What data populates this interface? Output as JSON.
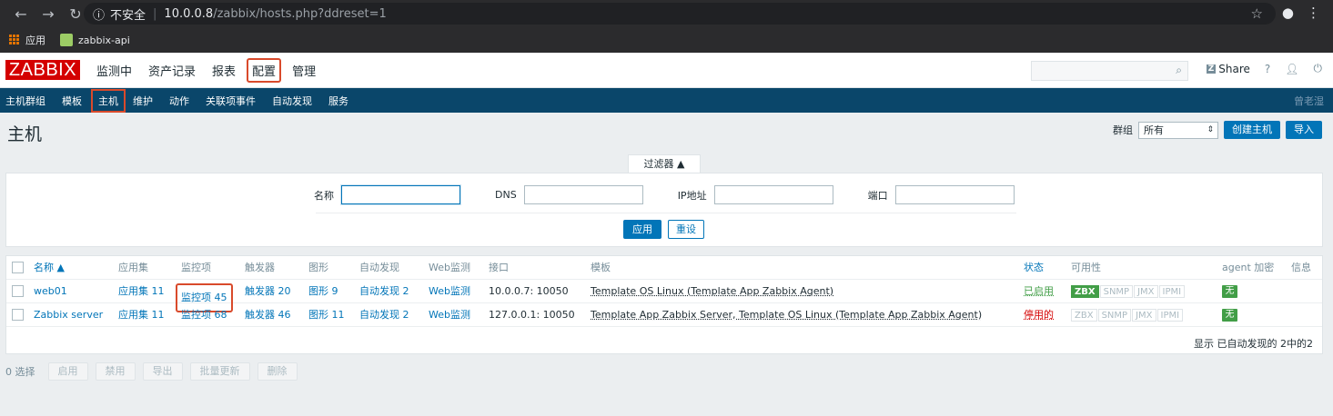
{
  "browser": {
    "security_label": "不安全",
    "url_host": "10.0.0.8",
    "url_path": "/zabbix/hosts.php?ddreset=1",
    "bookmarks": [
      "应用",
      "zabbix-api"
    ]
  },
  "topbar": {
    "logo": "ZABBIX",
    "menu": [
      "监测中",
      "资产记录",
      "报表",
      "配置",
      "管理"
    ],
    "share": "Share",
    "help": "?"
  },
  "submenu": {
    "items": [
      "主机群组",
      "模板",
      "主机",
      "维护",
      "动作",
      "关联项事件",
      "自动发现",
      "服务"
    ],
    "user": "曾老湿"
  },
  "page": {
    "title": "主机",
    "group_label": "群组",
    "group_value": "所有",
    "create_button": "创建主机",
    "import_button": "导入"
  },
  "filter": {
    "tab_label": "过滤器 ▲",
    "name_label": "名称",
    "dns_label": "DNS",
    "ip_label": "IP地址",
    "port_label": "端口",
    "apply": "应用",
    "reset": "重设"
  },
  "table": {
    "headers": {
      "name": "名称 ▲",
      "applications": "应用集",
      "items": "监控项",
      "triggers": "触发器",
      "graphs": "图形",
      "discovery": "自动发现",
      "web": "Web监测",
      "interface": "接口",
      "templates": "模板",
      "status": "状态",
      "availability": "可用性",
      "agent_encryption": "agent 加密",
      "info": "信息"
    },
    "rows": [
      {
        "name": "web01",
        "applications": "应用集 11",
        "items": "监控项 45",
        "triggers": "触发器 20",
        "graphs": "图形 9",
        "discovery": "自动发现 2",
        "web": "Web监测",
        "interface": "10.0.0.7: 10050",
        "templates": "Template OS Linux (Template App Zabbix Agent)",
        "status": "已启用",
        "encryption": "无"
      },
      {
        "name": "Zabbix server",
        "applications": "应用集 11",
        "items": "监控项 68",
        "triggers": "触发器 46",
        "graphs": "图形 11",
        "discovery": "自动发现 2",
        "web": "Web监测",
        "interface": "127.0.0.1: 10050",
        "templates": "Template App Zabbix Server, Template OS Linux (Template App Zabbix Agent)",
        "status": "停用的",
        "encryption": "无"
      }
    ],
    "availability_labels": [
      "ZBX",
      "SNMP",
      "JMX",
      "IPMI"
    ],
    "footer": "显示 已自动发现的 2中的2"
  },
  "bulk": {
    "selected": "0 选择",
    "buttons": [
      "启用",
      "禁用",
      "导出",
      "批量更新",
      "删除"
    ]
  },
  "colors": {
    "brand": "#d40000",
    "nav": "#0a466a",
    "primary": "#0275b8",
    "ok": "#429e47",
    "highlight": "#d94a2b"
  }
}
